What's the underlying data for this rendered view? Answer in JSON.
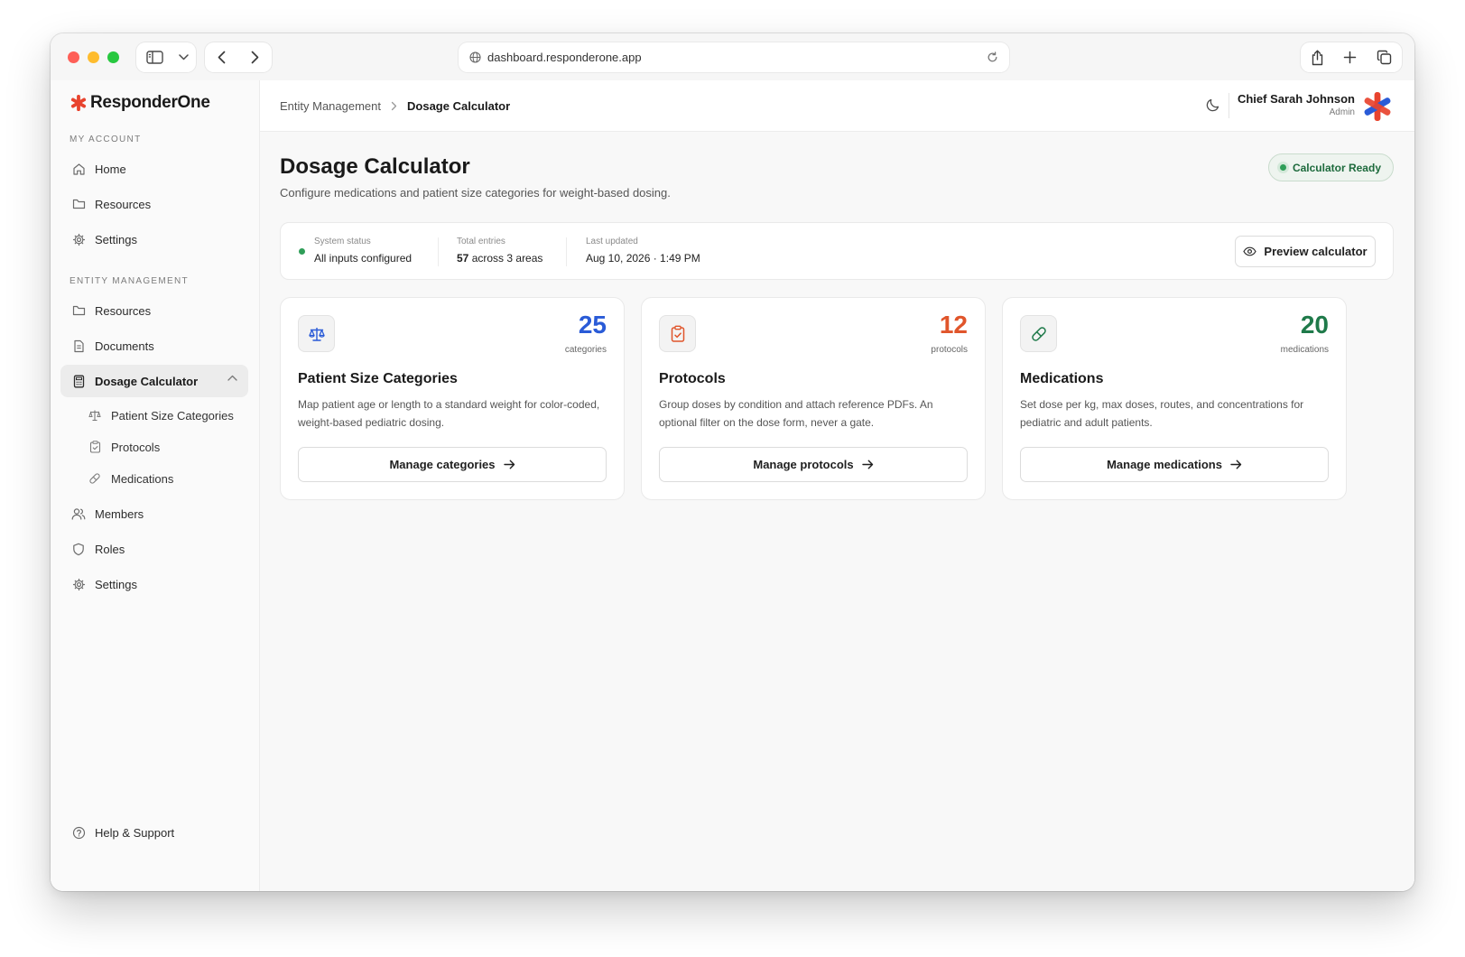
{
  "browser": {
    "url": "dashboard.responderone.app"
  },
  "brand": {
    "name": "ResponderOne",
    "accent_red": "#e8432e",
    "accent_blue": "#2a5bd7"
  },
  "sidebar": {
    "section_my_account": "MY ACCOUNT",
    "my_account_items": [
      {
        "label": "Home",
        "icon": "home-icon"
      },
      {
        "label": "Resources",
        "icon": "folder-icon"
      },
      {
        "label": "Settings",
        "icon": "gear-icon"
      }
    ],
    "section_entity": "ENTITY MANAGEMENT",
    "entity_items": [
      {
        "label": "Resources",
        "icon": "folder-icon"
      },
      {
        "label": "Documents",
        "icon": "document-icon"
      },
      {
        "label": "Dosage Calculator",
        "icon": "calculator-icon"
      }
    ],
    "sub_items": [
      {
        "label": "Patient Size Categories",
        "icon": "scale-icon"
      },
      {
        "label": "Protocols",
        "icon": "clipboard-icon"
      },
      {
        "label": "Medications",
        "icon": "pill-icon"
      }
    ],
    "bottom_items": [
      {
        "label": "Members",
        "icon": "users-icon"
      },
      {
        "label": "Roles",
        "icon": "shield-icon"
      },
      {
        "label": "Settings",
        "icon": "gear-icon"
      }
    ],
    "help": "Help & Support"
  },
  "header": {
    "breadcrumb_parent": "Entity Management",
    "breadcrumb_current": "Dosage Calculator",
    "user_name": "Chief Sarah Johnson",
    "user_role": "Admin"
  },
  "main": {
    "title": "Dosage Calculator",
    "subtitle": "Configure medications and patient size categories for weight-based dosing.",
    "badge": "Calculator Ready",
    "status": {
      "system_label": "System status",
      "system_value": "All inputs configured",
      "entries_label": "Total entries",
      "entries_count": "57",
      "entries_suffix": "across 3 areas",
      "updated_label": "Last updated",
      "updated_value": "Aug 10, 2026 · 1:49 PM",
      "preview_button": "Preview calculator"
    },
    "cards": [
      {
        "count": "25",
        "unit": "categories",
        "title": "Patient Size Categories",
        "desc": "Map patient age or length to a standard weight for color-coded, weight-based pediatric dosing.",
        "button": "Manage categories",
        "color": "#2a5bd7",
        "icon": "scale-icon"
      },
      {
        "count": "12",
        "unit": "protocols",
        "title": "Protocols",
        "desc": "Group doses by condition and attach reference PDFs. An optional filter on the dose form, never a gate.",
        "button": "Manage protocols",
        "color": "#e0552b",
        "icon": "clipboard-icon"
      },
      {
        "count": "20",
        "unit": "medications",
        "title": "Medications",
        "desc": "Set dose per kg, max doses, routes, and concentrations for pediatric and adult patients.",
        "button": "Manage medications",
        "color": "#1f7a4a",
        "icon": "pill-icon"
      }
    ]
  }
}
